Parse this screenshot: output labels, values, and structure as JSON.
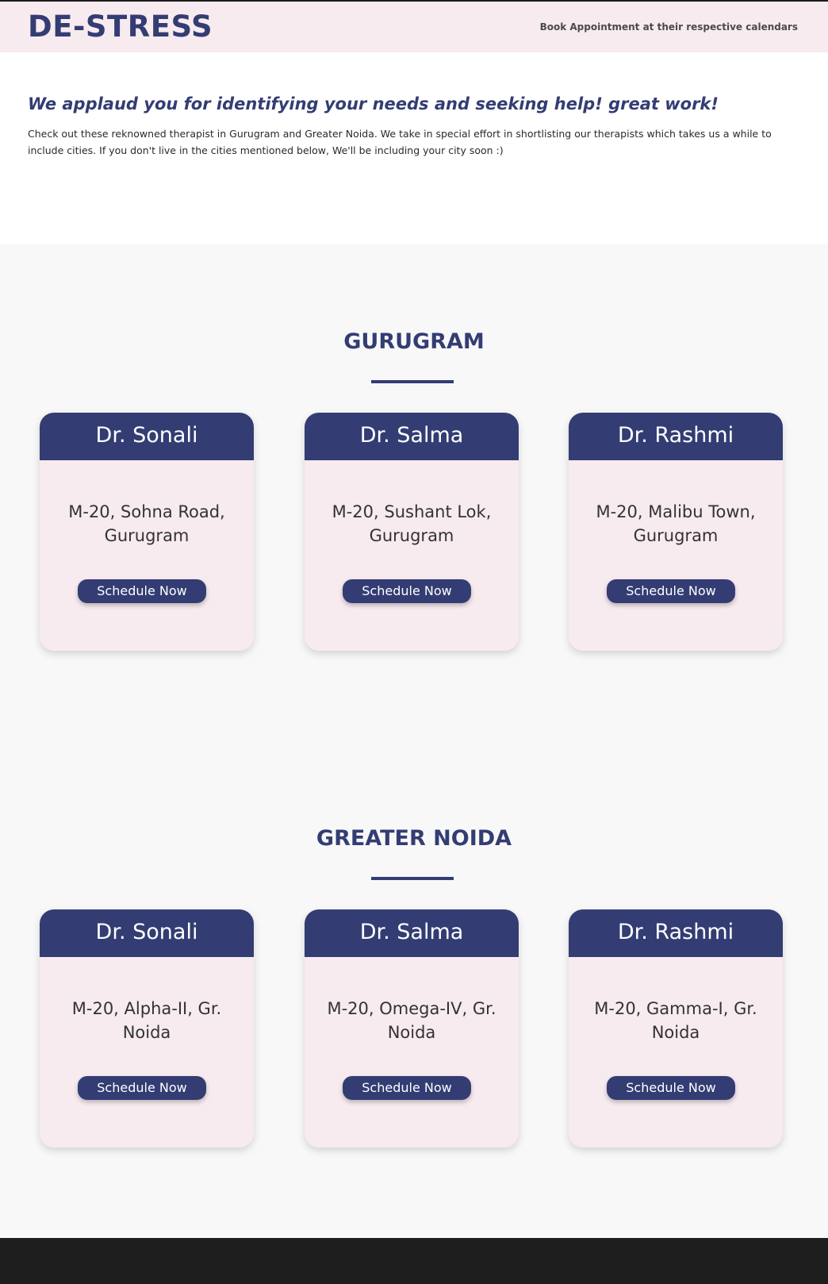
{
  "header": {
    "logo": "DE-STRESS",
    "link": "Book Appointment at their respective calendars"
  },
  "intro": {
    "title": "We applaud you for identifying your needs and seeking help! great work!",
    "text": "Check out these reknowned therapist in Gurugram and Greater Noida. We take in special effort in shortlisting our therapists which takes us a while to include cities. If you don't live in the cities mentioned below, We'll be including your city soon :)"
  },
  "sections": [
    {
      "title": "GURUGRAM",
      "cards": [
        {
          "name": "Dr. Sonali",
          "address": "M-20, Sohna Road, Gurugram",
          "button": "Schedule Now"
        },
        {
          "name": "Dr. Salma",
          "address": "M-20, Sushant Lok, Gurugram",
          "button": "Schedule Now"
        },
        {
          "name": "Dr. Rashmi",
          "address": "M-20, Malibu Town, Gurugram",
          "button": "Schedule Now"
        }
      ]
    },
    {
      "title": "GREATER NOIDA",
      "cards": [
        {
          "name": "Dr. Sonali",
          "address": "M-20, Alpha-II, Gr. Noida",
          "button": "Schedule Now"
        },
        {
          "name": "Dr. Salma",
          "address": "M-20, Omega-IV, Gr. Noida",
          "button": "Schedule Now"
        },
        {
          "name": "Dr. Rashmi",
          "address": "M-20, Gamma-I, Gr. Noida",
          "button": "Schedule Now"
        }
      ]
    }
  ],
  "colors": {
    "primary": "#333d73",
    "card_background": "#f7ebef",
    "header_background": "#f7ebef",
    "page_background": "#f8f8f8",
    "footer_background": "#1e1e1e"
  }
}
